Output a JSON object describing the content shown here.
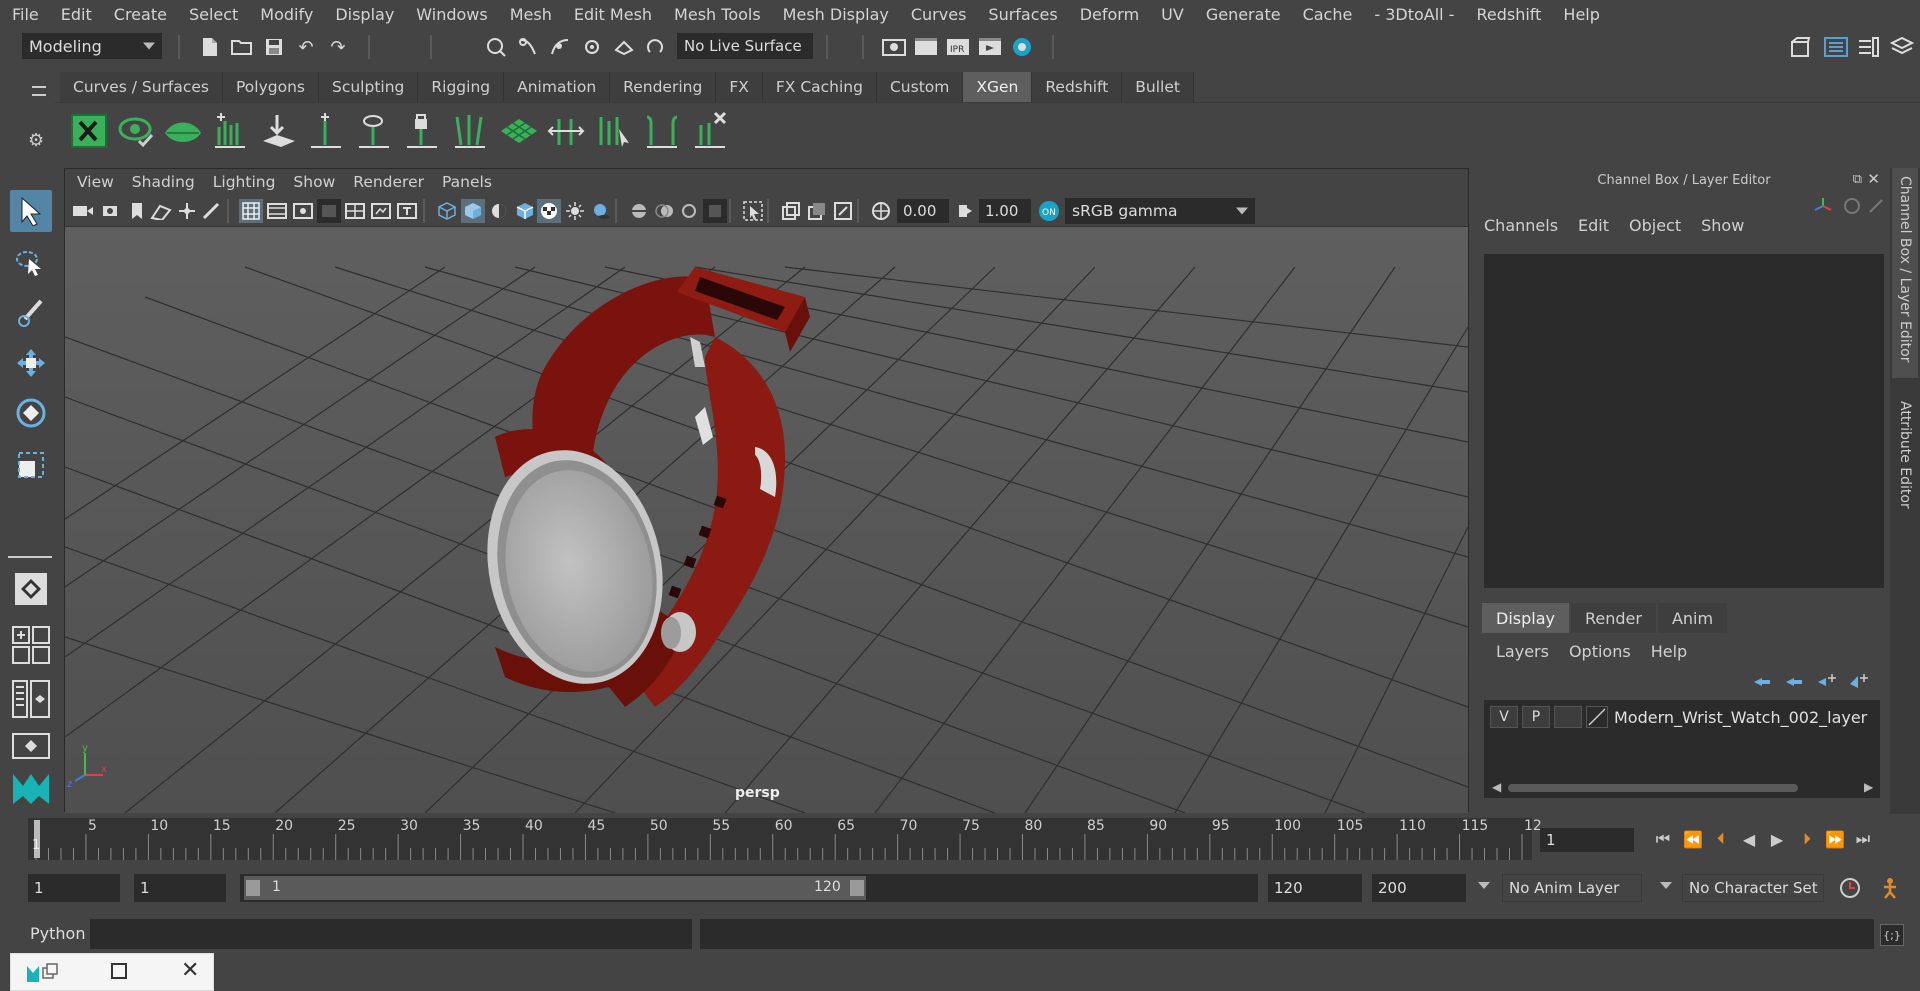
{
  "menubar": [
    "File",
    "Edit",
    "Create",
    "Select",
    "Modify",
    "Display",
    "Windows",
    "Mesh",
    "Edit Mesh",
    "Mesh Tools",
    "Mesh Display",
    "Curves",
    "Surfaces",
    "Deform",
    "UV",
    "Generate",
    "Cache",
    "- 3DtoAll -",
    "Redshift",
    "Help"
  ],
  "statusline": {
    "mode": "Modeling",
    "live_surface": "No Live Surface"
  },
  "shelf": {
    "tabs": [
      "Curves / Surfaces",
      "Polygons",
      "Sculpting",
      "Rigging",
      "Animation",
      "Rendering",
      "FX",
      "FX Caching",
      "Custom",
      "XGen",
      "Redshift",
      "Bullet"
    ],
    "active_tab": "XGen"
  },
  "viewport": {
    "menu": [
      "View",
      "Shading",
      "Lighting",
      "Show",
      "Renderer",
      "Panels"
    ],
    "exposure": "0.00",
    "gamma": "1.00",
    "color_space": "sRGB gamma",
    "camera_label": "persp"
  },
  "right_panel": {
    "title": "Channel Box / Layer Editor",
    "menu": [
      "Channels",
      "Edit",
      "Object",
      "Show"
    ],
    "tabs": [
      "Display",
      "Render",
      "Anim"
    ],
    "active_tab": "Display",
    "layer_menu": [
      "Layers",
      "Options",
      "Help"
    ],
    "layer": {
      "v": "V",
      "p": "P",
      "name": "Modern_Wrist_Watch_002_layer"
    },
    "side_tabs": [
      "Channel Box / Layer Editor",
      "Attribute Editor"
    ]
  },
  "timeline": {
    "ticks": [
      "5",
      "10",
      "15",
      "20",
      "25",
      "30",
      "35",
      "40",
      "45",
      "50",
      "55",
      "60",
      "65",
      "70",
      "75",
      "80",
      "85",
      "90",
      "95",
      "100",
      "105",
      "110",
      "115",
      "12"
    ],
    "current_frame_marker": "1",
    "current_frame": "1"
  },
  "range": {
    "start_frame": "1",
    "playback_start": "1",
    "slider_start": "1",
    "slider_end": "120",
    "playback_end": "120",
    "end_frame": "200",
    "anim_layer": "No Anim Layer",
    "character_set": "No Character Set"
  },
  "command_line": {
    "language": "Python"
  },
  "colors": {
    "accent": "#5285a6",
    "strap": "#7a130d",
    "case": "#c7c7c7",
    "xgen_green": "#3bb05a"
  }
}
